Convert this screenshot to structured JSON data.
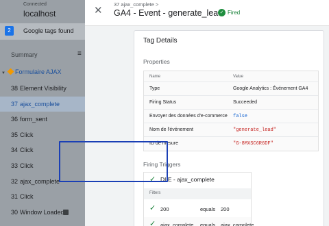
{
  "sidebar": {
    "connected_label": "Connected",
    "host": "localhost",
    "tags_count": "2",
    "tags_label": "Google tags found",
    "summary_label": "Summary",
    "group_label": "Formulaire AJAX",
    "items": [
      {
        "num": "38",
        "label": "Element Visibility",
        "active": false
      },
      {
        "num": "37",
        "label": "ajax_complete",
        "active": true
      },
      {
        "num": "36",
        "label": "form_sent",
        "active": false
      },
      {
        "num": "35",
        "label": "Click",
        "active": false
      },
      {
        "num": "34",
        "label": "Click",
        "active": false
      },
      {
        "num": "33",
        "label": "Click",
        "active": false
      },
      {
        "num": "32",
        "label": "ajax_complete",
        "active": false
      },
      {
        "num": "31",
        "label": "Click",
        "active": false
      },
      {
        "num": "30",
        "label": "Window Loaded",
        "active": false
      }
    ]
  },
  "header": {
    "breadcrumb": "37 ajax_complete >",
    "title": "GA4 - Event - generate_lead",
    "status": "Fired"
  },
  "details": {
    "card_title": "Tag Details",
    "properties_title": "Properties",
    "col_name": "Name",
    "col_value": "Value",
    "rows": [
      {
        "name": "Type",
        "value": "Google Analytics : Événement GA4",
        "kind": "plain"
      },
      {
        "name": "Firing Status",
        "value": "Succeeded",
        "kind": "plain"
      },
      {
        "name": "Envoyer des données d'e-commerce",
        "value": "false",
        "kind": "code"
      },
      {
        "name": "Nom de l'événement",
        "value": "\"generate_lead\"",
        "kind": "str"
      },
      {
        "name": "ID de mesure",
        "value": "\"G-8MXSC6R6DF\"",
        "kind": "str"
      }
    ],
    "triggers_title": "Firing Triggers",
    "trigger_name": "DLE - ajax_complete",
    "filters_label": "Filters",
    "filters": [
      {
        "left": "200",
        "op": "equals",
        "right": "200"
      },
      {
        "left": "ajax_complete",
        "op": "equals",
        "right": "ajax_complete"
      }
    ]
  },
  "colors": {
    "accent": "#1a73e8",
    "fired": "#188038",
    "highlight": "#1a3fb5"
  }
}
